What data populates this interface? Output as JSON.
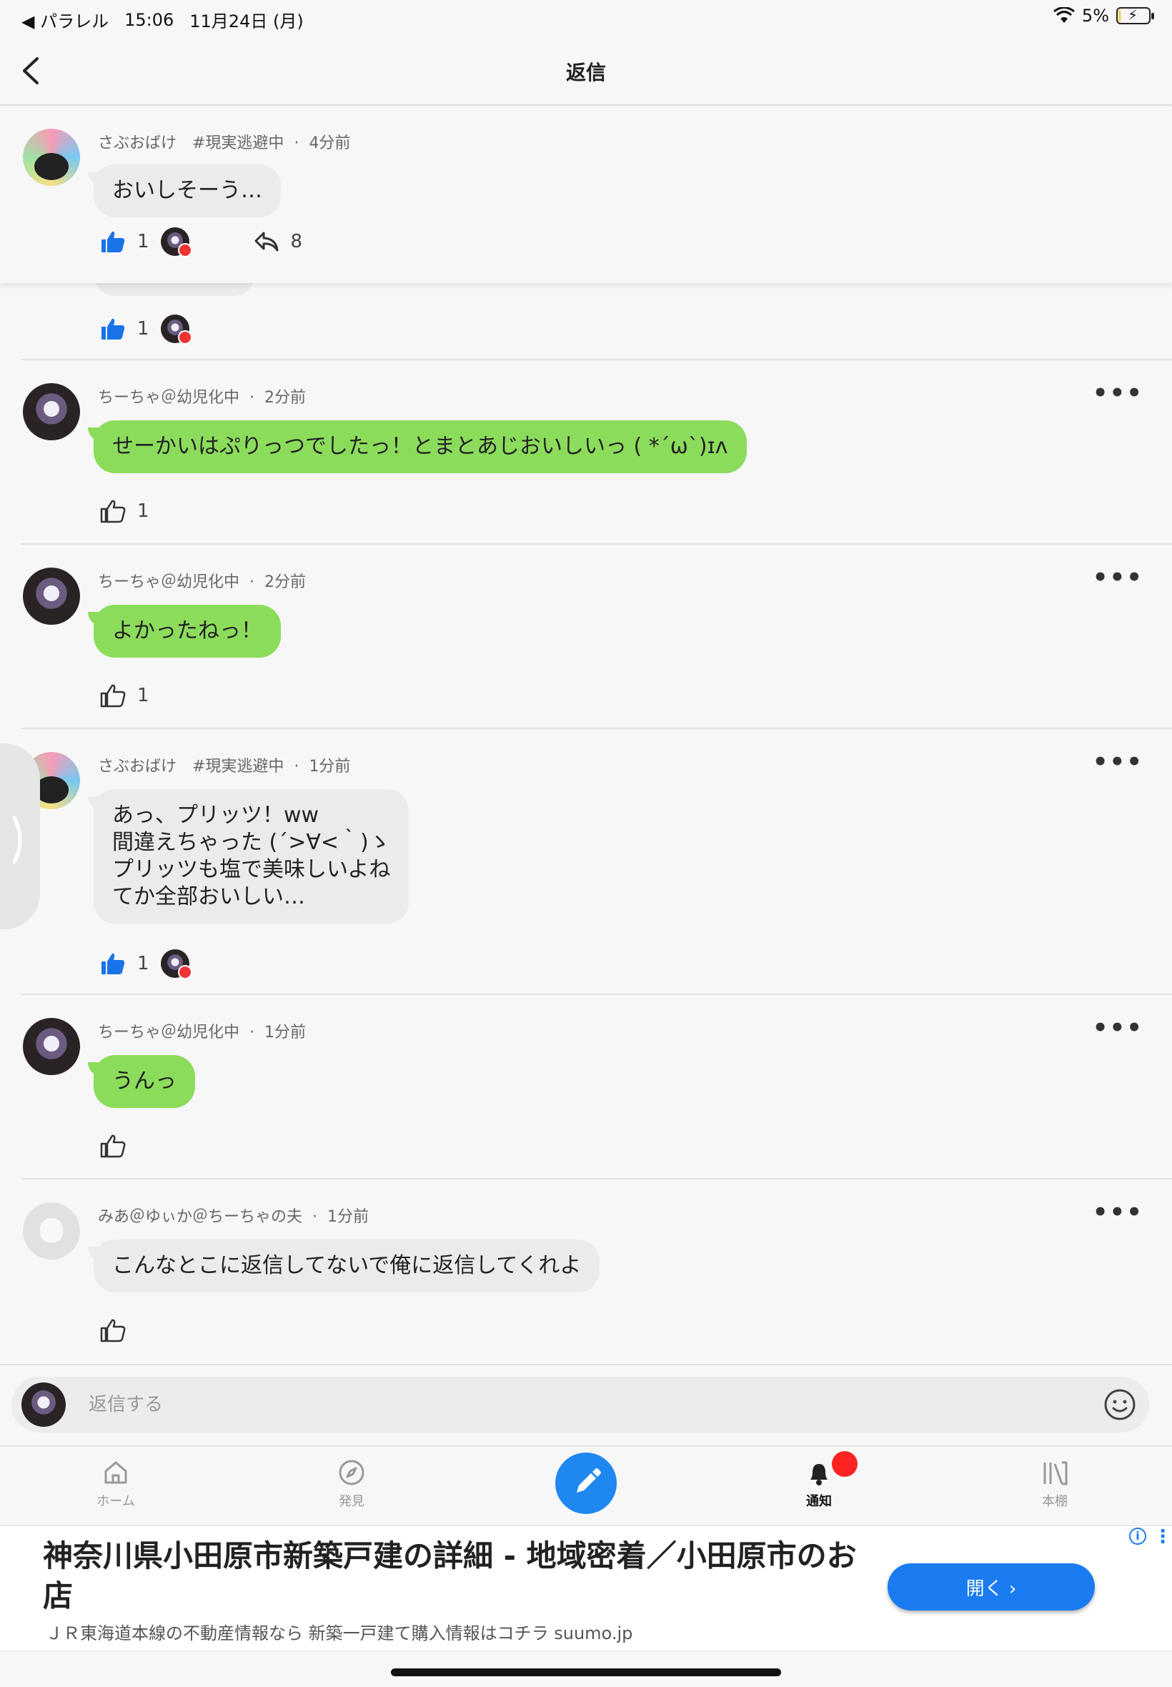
{
  "status": {
    "carrier": "◀ パラレル",
    "time": "15:06",
    "date": "11月24日 (月)",
    "battery": "5%",
    "battery_level": 0.05
  },
  "header": {
    "title": "返信"
  },
  "pinned": {
    "author": "さぶおばけ　#現実逃避中",
    "time": "4分前",
    "text": "おいしそーう…",
    "likes": "1",
    "replies": "8"
  },
  "hidden_likes": "1",
  "comments": [
    {
      "author": "ちーちゃ＠幼児化中",
      "time": "2分前",
      "text": "せーかいはぷりっつでしたっ！とまとあじおいしいっ ( *´ω`)ɪʌ",
      "likes": "1"
    },
    {
      "author": "ちーちゃ＠幼児化中",
      "time": "2分前",
      "text": "よかったねっ！",
      "likes": "1"
    },
    {
      "author": "さぶおばけ　#現実逃避中",
      "time": "1分前",
      "lines": [
        "あっ、プリッツ！ww",
        "間違えちゃった (´>∀<｀)ゝ",
        "プリッツも塩で美味しいよね",
        "てか全部おいしい…"
      ],
      "likes": "1"
    },
    {
      "author": "ちーちゃ＠幼児化中",
      "time": "1分前",
      "text": "うんっ",
      "likes": ""
    },
    {
      "author": "みあ＠ゆぃか＠ちーちゃの夫",
      "time": "1分前",
      "text": "こんなとこに返信してないで俺に返信してくれよ",
      "likes": ""
    }
  ],
  "more_label": "•••",
  "reply": {
    "placeholder": "返信する"
  },
  "tabs": {
    "home": "ホーム",
    "discover": "発見",
    "notify": "通知",
    "shelf": "本棚"
  },
  "ad": {
    "title": "神奈川県小田原市新築戸建の詳細 - 地域密着／小田原市のお店",
    "desc": "ＪＲ東海道本線の不動産情報なら 新築一戸建て購入情報はコチラ suumo.jp",
    "button": "開く ›"
  },
  "colors": {
    "accent": "#1e88f0",
    "green_bubble": "#8cdc5c",
    "gray_bubble": "#ebebeb",
    "like_blue": "#1a73e8"
  }
}
